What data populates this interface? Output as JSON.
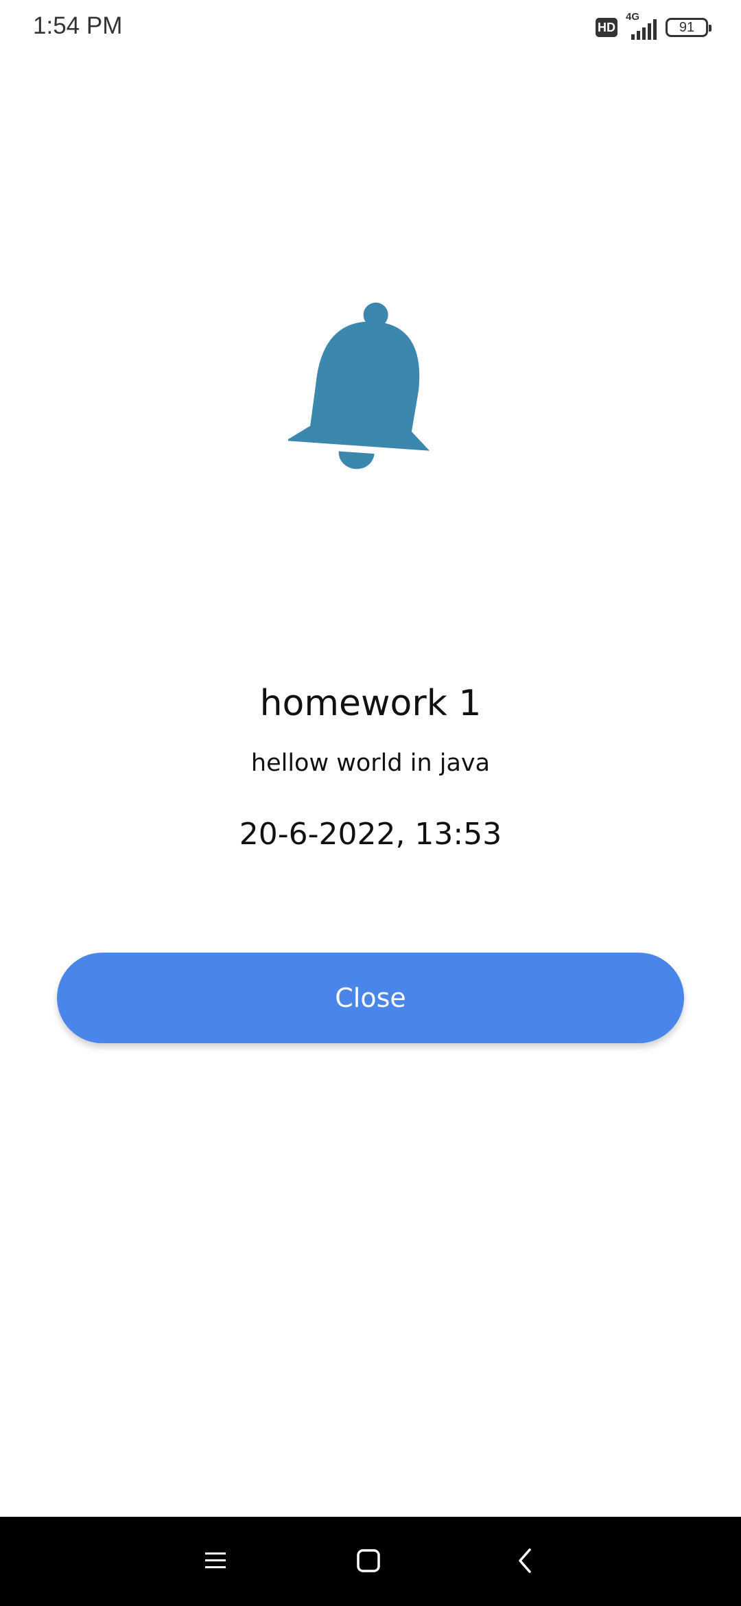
{
  "status_bar": {
    "time": "1:54 PM",
    "hd_label": "HD",
    "network_type": "4G",
    "battery_level": "91",
    "icons": [
      "hd-icon",
      "signal-icon",
      "battery-icon"
    ]
  },
  "alarm": {
    "icon": "bell-icon",
    "icon_color": "#3b87ad",
    "title": "homework 1",
    "description": "hellow world in java",
    "datetime": "20-6-2022, 13:53"
  },
  "actions": {
    "close_label": "Close",
    "button_color": "#4a86ea"
  },
  "navigation": {
    "icons": [
      "menu-icon",
      "home-icon",
      "back-icon"
    ]
  }
}
